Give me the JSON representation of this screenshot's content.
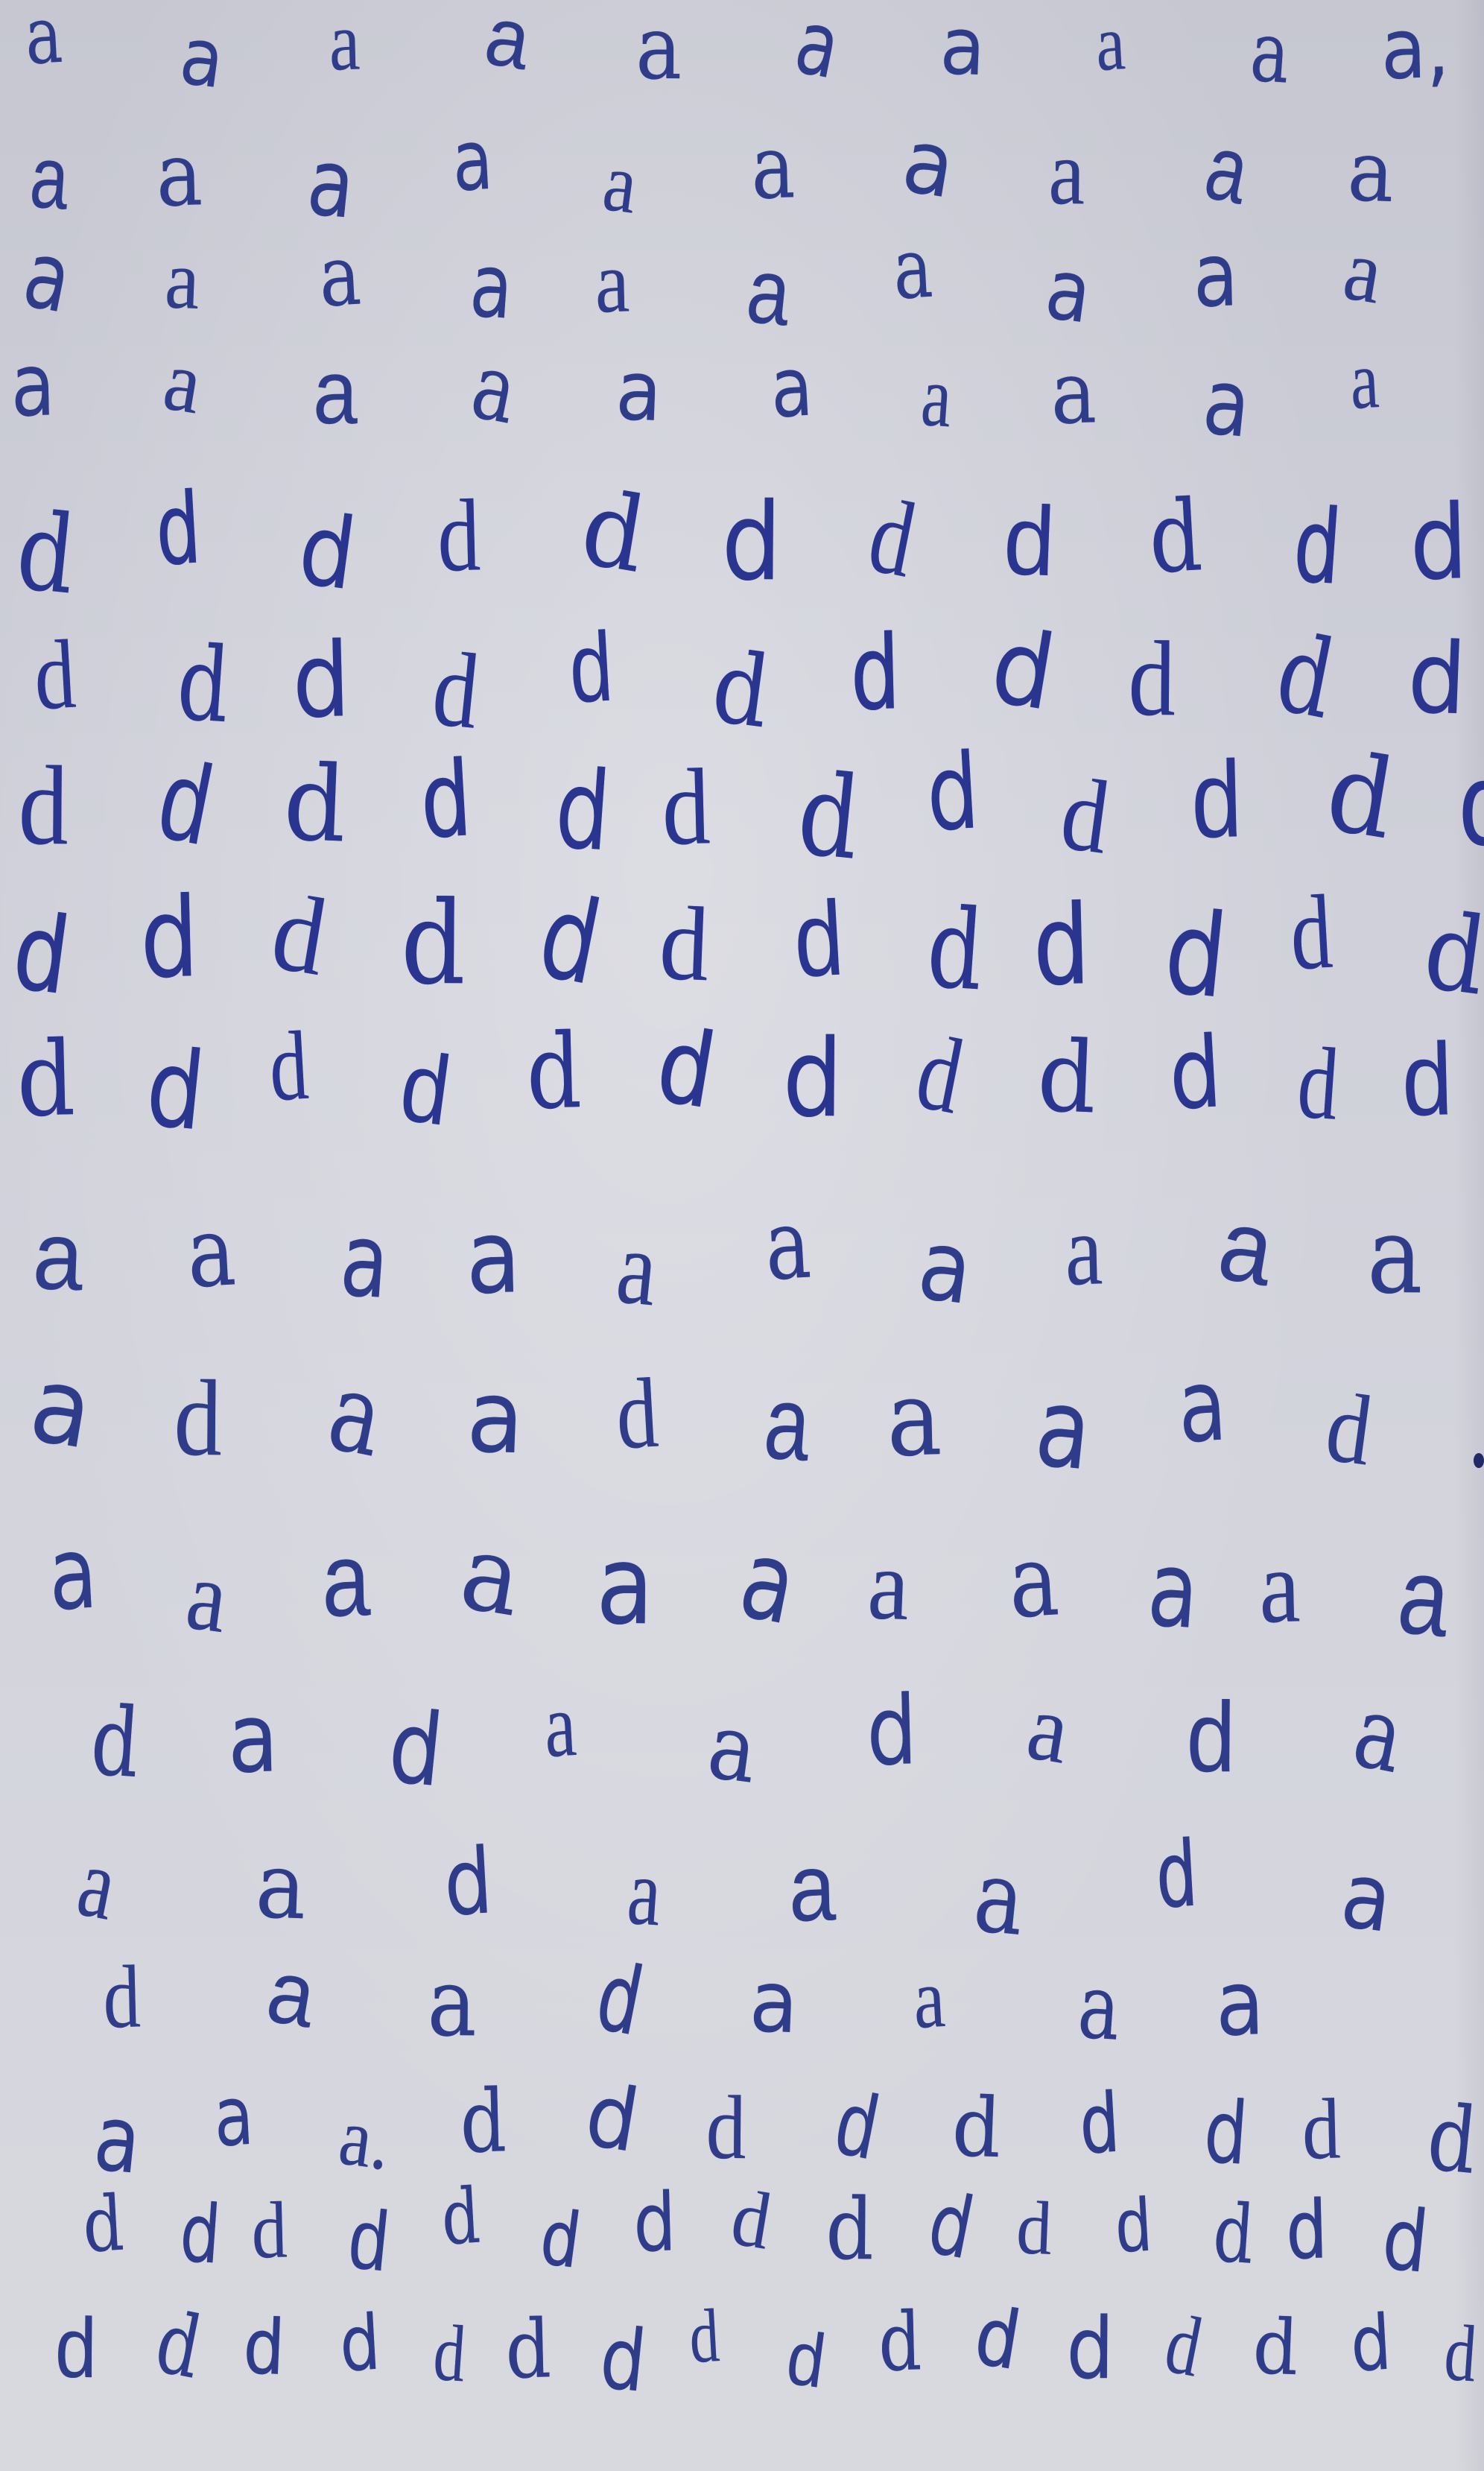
{
  "sheet": {
    "ink_color": "#2c3a8e",
    "paper_color": "#cfd0d9",
    "rows": [
      {
        "glyphs": [
          "a",
          "a",
          "a",
          "a",
          "a",
          "a",
          "a",
          "a",
          "a",
          "a,"
        ]
      },
      {
        "glyphs": [
          "a",
          "a",
          "a",
          "a",
          "a",
          "a",
          "a",
          "a",
          "a",
          "a"
        ]
      },
      {
        "glyphs": [
          "a",
          "a",
          "a",
          "a",
          "a",
          "a",
          "a",
          "a",
          "a",
          "a"
        ]
      },
      {
        "glyphs": [
          "a",
          "a",
          "a",
          "a",
          "a",
          "a",
          "a",
          "a",
          "a",
          "a"
        ]
      },
      {
        "glyphs": [
          "d",
          "d",
          "d",
          "d",
          "d",
          "d",
          "d",
          "d",
          "d",
          "d",
          "d"
        ]
      },
      {
        "glyphs": [
          "d",
          "d",
          "d",
          "d",
          "d",
          "d",
          "d",
          "d",
          "d",
          "d",
          "d"
        ]
      },
      {
        "glyphs": [
          "d",
          "d",
          "d",
          "d",
          "d",
          "d",
          "d",
          "d",
          "d",
          "d",
          "d",
          "d"
        ]
      },
      {
        "glyphs": [
          "d",
          "d",
          "d",
          "d",
          "d",
          "d",
          "d",
          "d",
          "d",
          "d",
          "d",
          "d"
        ]
      },
      {
        "glyphs": [
          "d",
          "d",
          "d",
          "d",
          "d",
          "d",
          "d",
          "d",
          "d",
          "d",
          "d",
          "d"
        ]
      },
      {
        "glyphs": [
          "a",
          "a",
          "a",
          "a",
          "a",
          "a",
          "a",
          "a",
          "a",
          "a"
        ]
      },
      {
        "glyphs": [
          "a",
          "d",
          "a",
          "a",
          "d",
          "a",
          "a",
          "a",
          "a",
          "d"
        ]
      },
      {
        "glyphs": [
          "a",
          "a",
          "a",
          "a",
          "a",
          "a",
          "a",
          "a",
          "a",
          "a",
          "a"
        ]
      },
      {
        "glyphs": [
          "d",
          "a",
          "d",
          "a",
          "a",
          "d",
          "a",
          "d",
          "a"
        ]
      },
      {
        "glyphs": [
          "a",
          "a",
          "d",
          "a",
          "a",
          "a",
          "d",
          "a"
        ]
      },
      {
        "glyphs": [
          "d",
          "a",
          "a",
          "d",
          "a",
          "a",
          "a",
          "a"
        ]
      },
      {
        "glyphs": [
          "a",
          "a",
          "a.",
          "d",
          "d",
          "d",
          "d",
          "d",
          "d",
          "d",
          "d",
          "d"
        ]
      },
      {
        "glyphs": [
          "d",
          "d",
          "d",
          "d",
          "d",
          "d",
          "d",
          "d",
          "d",
          "d",
          "d",
          "d",
          "d",
          "d",
          "d"
        ]
      },
      {
        "glyphs": [
          "d",
          "d",
          "d",
          "d",
          "d",
          "d",
          "d",
          "d",
          "d",
          "d",
          "d",
          "d",
          "d",
          "d",
          "d",
          "d"
        ]
      }
    ]
  }
}
